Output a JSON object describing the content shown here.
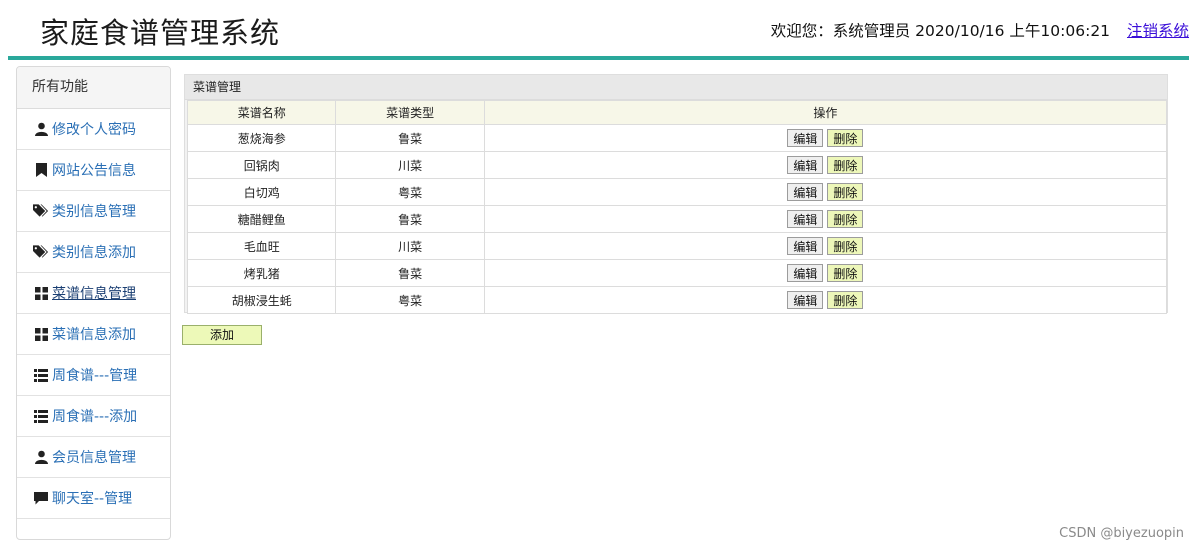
{
  "header": {
    "title": "家庭食谱管理系统",
    "welcome": "欢迎您：系统管理员 2020/10/16 上午10:06:21",
    "logout": "注销系统"
  },
  "sidebar": {
    "heading": "所有功能",
    "items": [
      {
        "label": "修改个人密码",
        "icon": "user-icon"
      },
      {
        "label": "网站公告信息",
        "icon": "bookmark-icon"
      },
      {
        "label": "类别信息管理",
        "icon": "tags-icon"
      },
      {
        "label": "类别信息添加",
        "icon": "tags-icon"
      },
      {
        "label": "菜谱信息管理",
        "icon": "grid-icon",
        "active": true
      },
      {
        "label": "菜谱信息添加",
        "icon": "grid-icon"
      },
      {
        "label": "周食谱---管理",
        "icon": "list-icon"
      },
      {
        "label": "周食谱---添加",
        "icon": "list-icon"
      },
      {
        "label": "会员信息管理",
        "icon": "user-icon"
      },
      {
        "label": "聊天室--管理",
        "icon": "comment-icon"
      }
    ]
  },
  "panel": {
    "title": "菜谱管理",
    "columns": [
      "菜谱名称",
      "菜谱类型",
      "操作"
    ],
    "edit_label": "编辑",
    "delete_label": "删除",
    "rows": [
      {
        "name": "葱烧海参",
        "type": "鲁菜"
      },
      {
        "name": "回锅肉",
        "type": "川菜"
      },
      {
        "name": "白切鸡",
        "type": "粤菜"
      },
      {
        "name": "糖醋鲤鱼",
        "type": "鲁菜"
      },
      {
        "name": "毛血旺",
        "type": "川菜"
      },
      {
        "name": "烤乳猪",
        "type": "鲁菜"
      },
      {
        "name": "胡椒浸生蚝",
        "type": "粤菜"
      }
    ],
    "add_label": "添加"
  },
  "watermark": "CSDN @biyezuopin",
  "colors": {
    "accent": "#2aa89b",
    "link": "#2a6fb5",
    "logout": "#3a0ed8",
    "delete_bg": "#edf7b9"
  }
}
